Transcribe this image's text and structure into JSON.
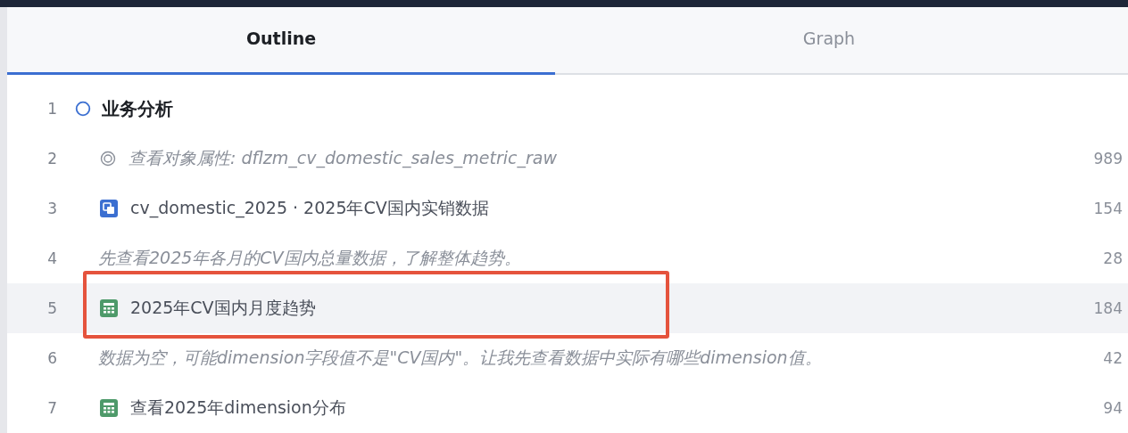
{
  "tabs": [
    {
      "label": "Outline",
      "selected": true
    },
    {
      "label": "Graph",
      "selected": false
    }
  ],
  "rows": [
    {
      "number": "1",
      "kind": "heading",
      "text": "业务分析",
      "count": "",
      "selected": false,
      "outlined": false
    },
    {
      "number": "2",
      "kind": "property",
      "text": "查看对象属性: dflzm_cv_domestic_sales_metric_raw",
      "count": "989",
      "selected": false,
      "outlined": false
    },
    {
      "number": "3",
      "kind": "dataset",
      "text": "cv_domestic_2025 · 2025年CV国内实销数据",
      "count": "154",
      "selected": false,
      "outlined": false
    },
    {
      "number": "4",
      "kind": "note",
      "text": "先查看2025年各月的CV国内总量数据，了解整体趋势。",
      "count": "28",
      "selected": false,
      "outlined": false
    },
    {
      "number": "5",
      "kind": "query",
      "text": "2025年CV国内月度趋势",
      "count": "184",
      "selected": true,
      "outlined": true
    },
    {
      "number": "6",
      "kind": "note",
      "text": "数据为空，可能dimension字段值不是\"CV国内\"。让我先查看数据中实际有哪些dimension值。",
      "count": "42",
      "selected": false,
      "outlined": false
    },
    {
      "number": "7",
      "kind": "query",
      "text": "查看2025年dimension分布",
      "count": "94",
      "selected": false,
      "outlined": false
    }
  ]
}
